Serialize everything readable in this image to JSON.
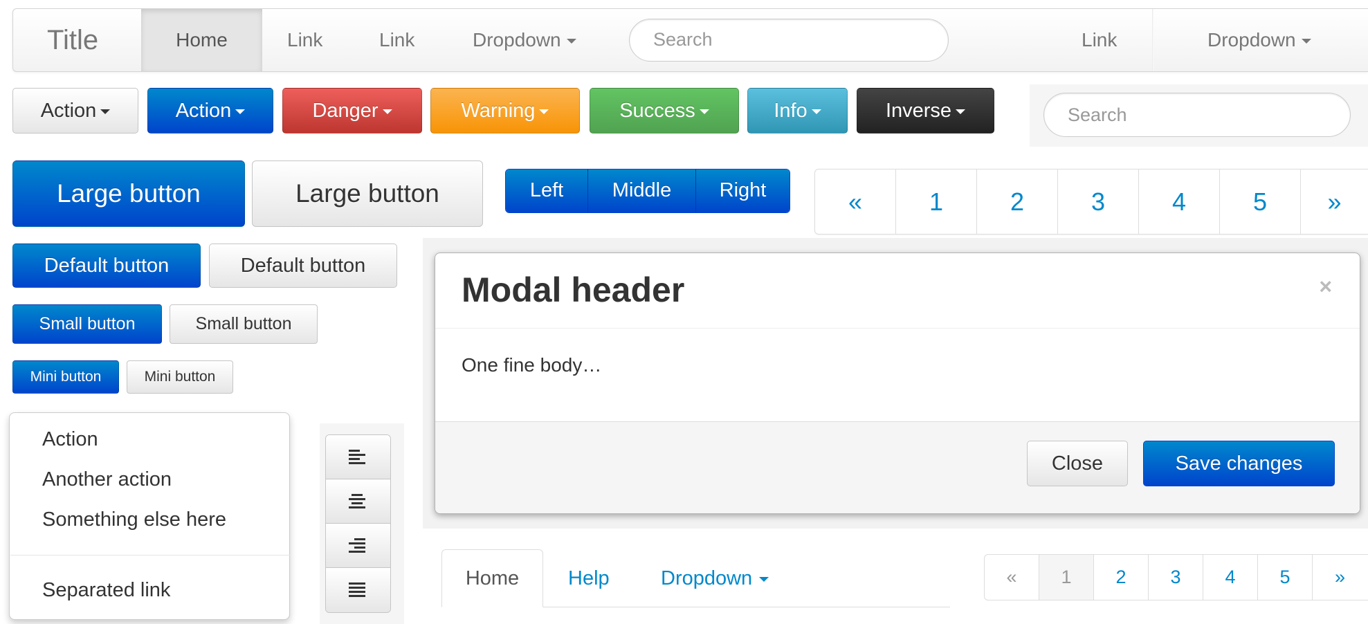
{
  "navbar": {
    "brand": "Title",
    "links": [
      "Home",
      "Link",
      "Link"
    ],
    "dropdown": "Dropdown",
    "search_placeholder": "Search",
    "right_link": "Link",
    "right_dropdown": "Dropdown"
  },
  "dropdown_buttons": [
    "Action",
    "Action",
    "Danger",
    "Warning",
    "Success",
    "Info",
    "Inverse"
  ],
  "search2_placeholder": "Search",
  "size_buttons": {
    "large": "Large button",
    "default": "Default button",
    "small": "Small button",
    "mini": "Mini button"
  },
  "button_group": [
    "Left",
    "Middle",
    "Right"
  ],
  "pagination_large": [
    "«",
    "1",
    "2",
    "3",
    "4",
    "5",
    "»"
  ],
  "modal": {
    "title": "Modal header",
    "close_glyph": "×",
    "body": "One fine body…",
    "close_button": "Close",
    "save_button": "Save changes"
  },
  "dropdown_menu": {
    "items": [
      "Action",
      "Another action",
      "Something else here"
    ],
    "separated": "Separated link"
  },
  "align_icons": [
    "align-left-icon",
    "align-center-icon",
    "align-right-icon",
    "align-justify-icon"
  ],
  "tabs": [
    "Home",
    "Help",
    "Dropdown"
  ],
  "pagination_small": [
    "«",
    "1",
    "2",
    "3",
    "4",
    "5",
    "»"
  ],
  "colors": {
    "primary": "#0044cc",
    "danger": "#bd362f",
    "warning": "#f89406",
    "success": "#51a351",
    "info": "#2f96b4",
    "inverse": "#222222",
    "link": "#0088cc"
  }
}
